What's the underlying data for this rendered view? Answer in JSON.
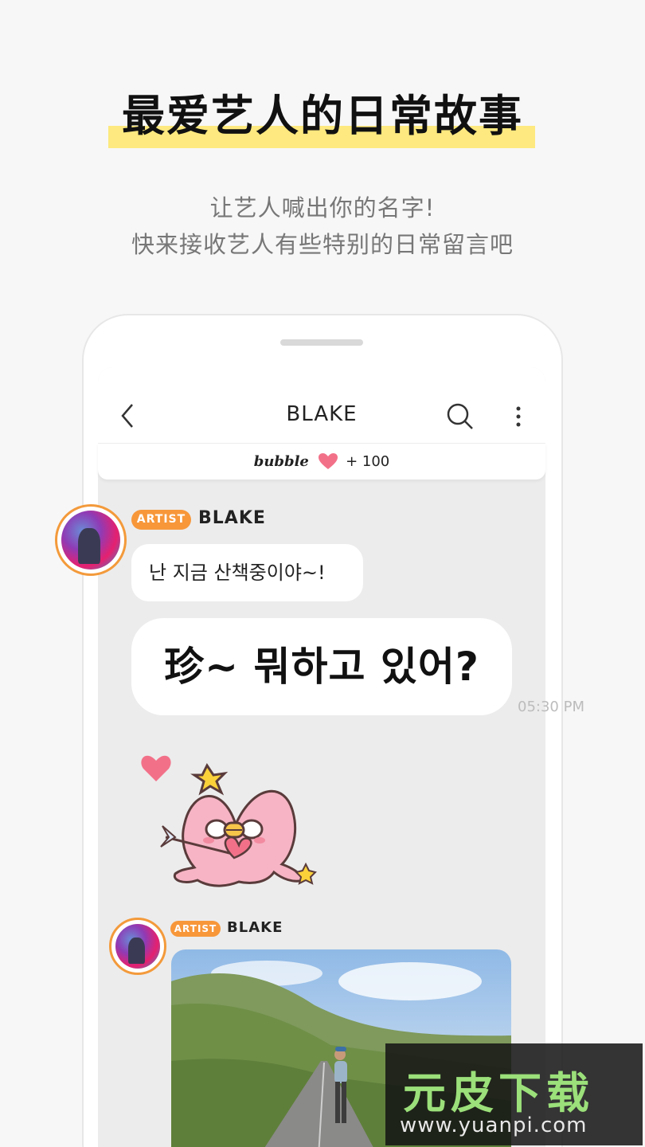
{
  "promo": {
    "headline": "最爱艺人的日常故事",
    "subtitle_line1": "让艺人喊出你的名字!",
    "subtitle_line2": "快来接收艺人有些特别的日常留言吧"
  },
  "appbar": {
    "title": "BLAKE",
    "icons": [
      "chevron-left-icon",
      "search-icon",
      "more-vertical-icon"
    ]
  },
  "bubble_bar": {
    "logo": "bubble",
    "count": "+ 100"
  },
  "messages": [
    {
      "badge": "ARTIST",
      "sender": "BLAKE",
      "text_small": "난 지금 산책중이야~!",
      "text_big": "珍~ 뭐하고 있어?",
      "time": "05:30 PM"
    },
    {
      "badge": "ARTIST",
      "sender": "BLAKE"
    }
  ],
  "watermark": {
    "main": "元皮下载",
    "url": "www.yuanpi.com"
  },
  "colors": {
    "accent_orange": "#f7973a",
    "highlight_yellow": "#fde97f",
    "heart_pink": "#f27189"
  }
}
